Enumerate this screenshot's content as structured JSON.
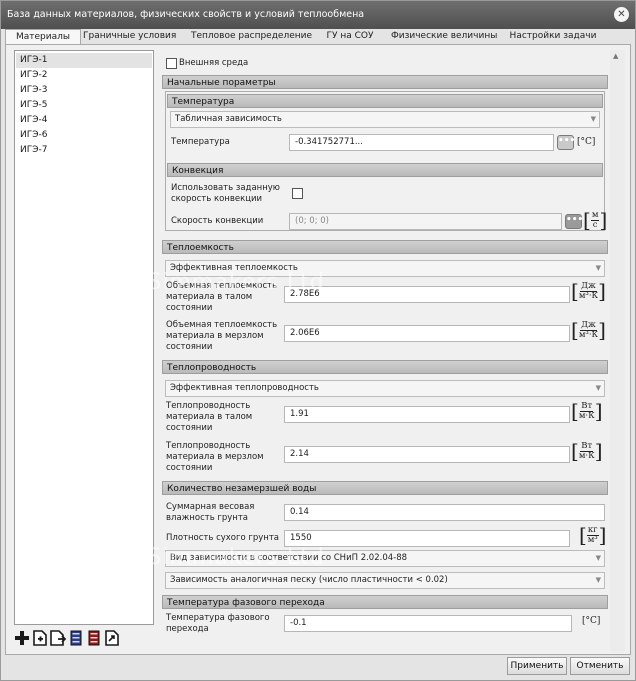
{
  "window": {
    "title": "База данных материалов, физических свойств и условий теплообмена"
  },
  "tabs": [
    {
      "label": "Материалы"
    },
    {
      "label": "Граничные условия"
    },
    {
      "label": "Тепловое распределение"
    },
    {
      "label": "ГУ на СОУ"
    },
    {
      "label": "Физические величины"
    },
    {
      "label": "Настройки задачи"
    }
  ],
  "materials": [
    "ИГЭ-1",
    "ИГЭ-2",
    "ИГЭ-3",
    "ИГЭ-5",
    "ИГЭ-4",
    "ИГЭ-6",
    "ИГЭ-7"
  ],
  "selected_material": "ИГЭ-1",
  "external_env": {
    "label": "Внешняя среда",
    "checked": false
  },
  "initial_params": {
    "header": "Начальные пораметры",
    "temperature": {
      "header": "Температура",
      "mode": "Табличная зависимость",
      "label": "Температура",
      "value": "-0.341752771...",
      "unit": "[°C]"
    },
    "convection": {
      "header": "Конвекция",
      "use_label_1": "Использовать заданную",
      "use_label_2": "скорость конвекции",
      "use_checked": false,
      "speed_label": "Скорость конвекции",
      "speed_value": "(0; 0; 0)",
      "unit_num": "м",
      "unit_den": "с"
    }
  },
  "heat_capacity": {
    "header": "Теплоемкость",
    "mode": "Эффективная теплоемкость",
    "thawed": {
      "label_1": "Объемная теплоемкость",
      "label_2": "материала в талом",
      "label_3": "состоянии",
      "value": "2.78E6"
    },
    "frozen": {
      "label_1": "Объемная теплоемкость",
      "label_2": "материала в мерзлом",
      "label_3": "состоянии",
      "value": "2.06E6"
    },
    "unit_num": "Дж",
    "unit_den": "м³·К"
  },
  "conductivity": {
    "header": "Теплопроводность",
    "mode": "Эффективная теплопроводность",
    "thawed": {
      "label_1": "Теплопроводность",
      "label_2": "материала в талом",
      "label_3": "состоянии",
      "value": "1.91"
    },
    "frozen": {
      "label_1": "Теплопроводность",
      "label_2": "материала в мерзлом",
      "label_3": "состоянии",
      "value": "2.14"
    },
    "unit_num": "Вт",
    "unit_den": "м·К"
  },
  "unfrozen_water": {
    "header": "Количество незамерзшей воды",
    "moisture_label_1": "Суммарная весовая",
    "moisture_label_2": "влажность грунта",
    "moisture_value": "0.14",
    "density_label": "Плотность сухого грунта",
    "density_value": "1550",
    "density_unit_num": "кг",
    "density_unit_den": "м³",
    "dependency_mode": "Вид зависимости в соответствии со СНиП 2.02.04-88",
    "analog_mode": "Зависимость аналогичная песку (число пластичности < 0.02)"
  },
  "phase_transition": {
    "header": "Температура фазового перехода",
    "label_1": "Температура фазового",
    "label_2": "перехода",
    "value": "-0.1",
    "unit": "[°C]"
  },
  "buttons": {
    "apply": "Применить",
    "cancel": "Отменить"
  },
  "watermark": "SimmakersSimmakers Ltd",
  "icons": [
    "add-icon",
    "new-document-icon",
    "copy-document-icon",
    "database-blue-icon",
    "database-red-icon",
    "export-document-icon"
  ]
}
